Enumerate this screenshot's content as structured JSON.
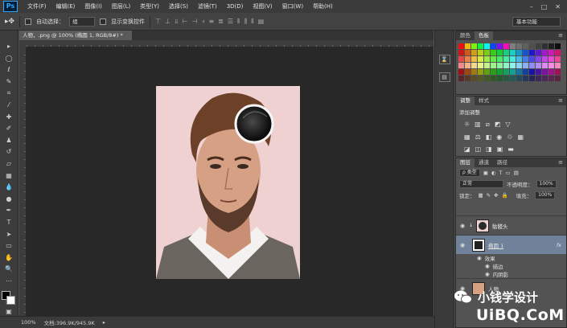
{
  "menubar": {
    "logo": "Ps",
    "items": [
      "文件(F)",
      "编辑(E)",
      "图像(I)",
      "图层(L)",
      "类型(Y)",
      "选择(S)",
      "滤镜(T)",
      "3D(D)",
      "视图(V)",
      "窗口(W)",
      "帮助(H)"
    ],
    "window_controls": [
      "–",
      "□",
      "✕"
    ]
  },
  "options": {
    "tool_glyph": "▸✥",
    "auto_select_label": "自动选择：",
    "auto_select_value": "组",
    "show_transform_label": "显示变换控件",
    "workspace": "基本功能"
  },
  "document": {
    "tab_title": "人物，.png @ 100% (椭圆 1, RGB/8#) *"
  },
  "status": {
    "zoom": "100%",
    "doc_size": "文档:396.9K/945.9K"
  },
  "panels": {
    "swatches_tabs": [
      "颜色",
      "色板"
    ],
    "adjust_tabs": [
      "调整",
      "样式"
    ],
    "adjust_title": "添加调整",
    "layers_tabs": [
      "图层",
      "通道",
      "路径"
    ],
    "kind_filter": "ρ 类型",
    "blend_mode": "正常",
    "opacity_label": "不透明度：",
    "opacity_value": "100%",
    "lock_label": "锁定：",
    "fill_label": "填充：",
    "fill_value": "100%",
    "layers": [
      {
        "name": "骷髅头"
      },
      {
        "name": "椭圆 1",
        "fx": "fx"
      },
      {
        "name": "人物"
      }
    ],
    "effects_label": "效果",
    "effect_items": [
      "描边",
      "内阴影"
    ]
  },
  "watermark": {
    "cn_text": "小钱学设计",
    "domain_text": "UiBQ.CoM"
  },
  "colors": {
    "accent": "#31a8ff",
    "selected_layer": "#6f829a",
    "canvas_bg": "#282828",
    "photo_bg": "#efd1d1"
  },
  "icons": {
    "eye": "eye-icon",
    "link": "link-icon",
    "fx": "fx-icon"
  }
}
